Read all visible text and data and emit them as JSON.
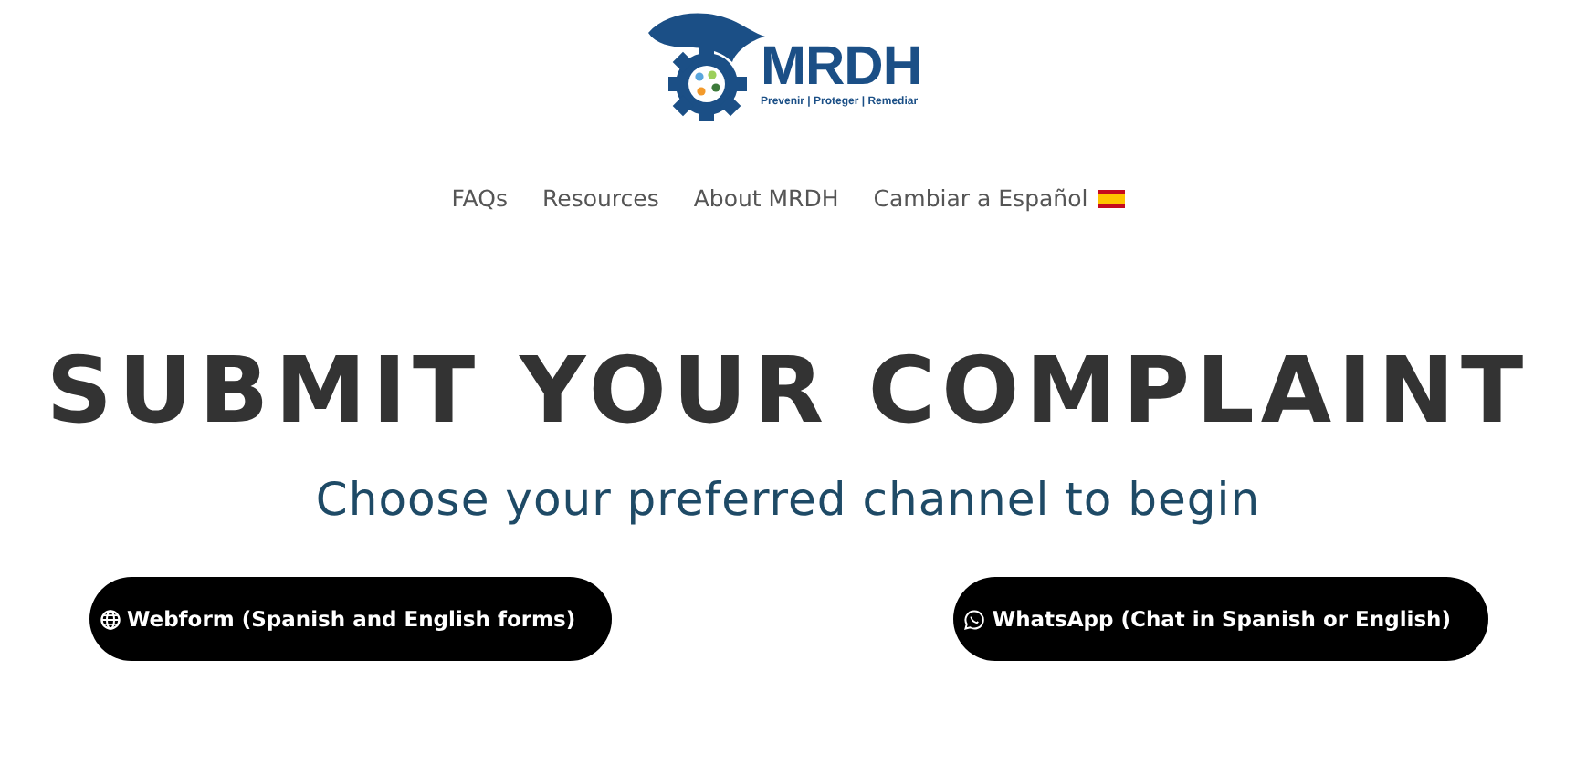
{
  "logo": {
    "name": "MRDH",
    "tagline": "Prevenir | Proteger | Remediar"
  },
  "nav": [
    {
      "label": "FAQs",
      "kind": "link"
    },
    {
      "label": "Resources",
      "kind": "link"
    },
    {
      "label": "About MRDH",
      "kind": "link"
    },
    {
      "label": "Cambiar a Español",
      "kind": "language"
    }
  ],
  "heading": "SUBMIT YOUR COMPLAINT",
  "subheading": "Choose your preferred channel to begin",
  "channels": [
    {
      "label": "Webform (Spanish and English forms)",
      "kind": "web"
    },
    {
      "label": "WhatsApp (Chat in Spanish or English)",
      "kind": "whatsapp"
    }
  ]
}
